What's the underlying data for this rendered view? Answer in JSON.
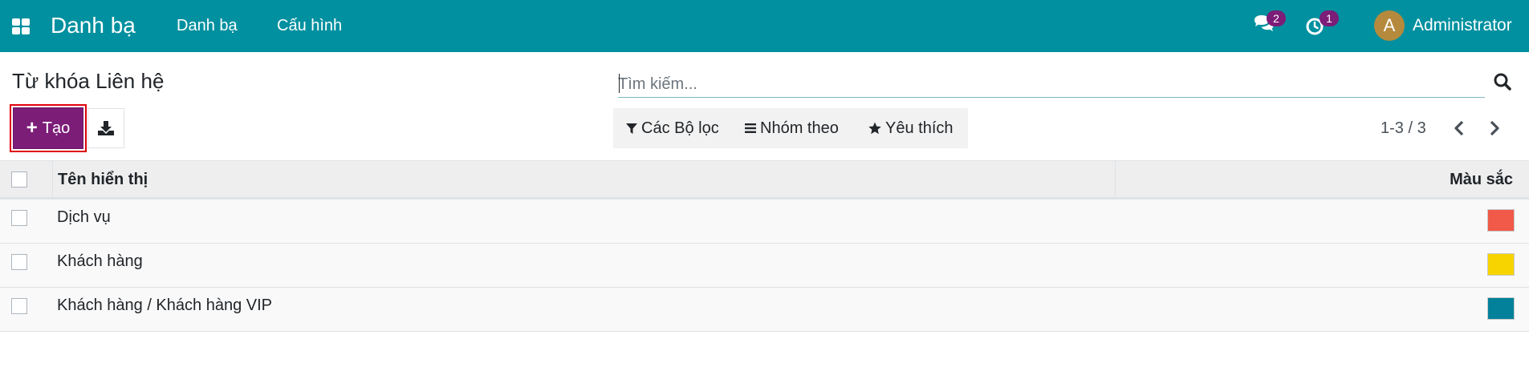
{
  "navbar": {
    "brand": "Danh bạ",
    "menu": [
      "Danh bạ",
      "Cấu hình"
    ],
    "chat_badge": "2",
    "activity_badge": "1",
    "user_initial": "A",
    "user_name": "Administrator"
  },
  "control_panel": {
    "title": "Từ khóa Liên hệ",
    "search_placeholder": "Tìm kiếm...",
    "create_label": "Tạo",
    "filters_label": "Các Bộ lọc",
    "group_by_label": "Nhóm theo",
    "favorites_label": "Yêu thích",
    "pager": "1-3 / 3"
  },
  "table": {
    "columns": [
      "Tên hiển thị",
      "Màu sắc"
    ],
    "rows": [
      {
        "name": "Dịch vụ",
        "color": "#f15a48"
      },
      {
        "name": "Khách hàng",
        "color": "#f7d400"
      },
      {
        "name": "Khách hàng / Khách hàng VIP",
        "color": "#04819a"
      }
    ]
  },
  "theme": {
    "navbar_bg": "#00909f",
    "primary_button": "#7c1d78",
    "highlight_outline": "#e0000b"
  }
}
